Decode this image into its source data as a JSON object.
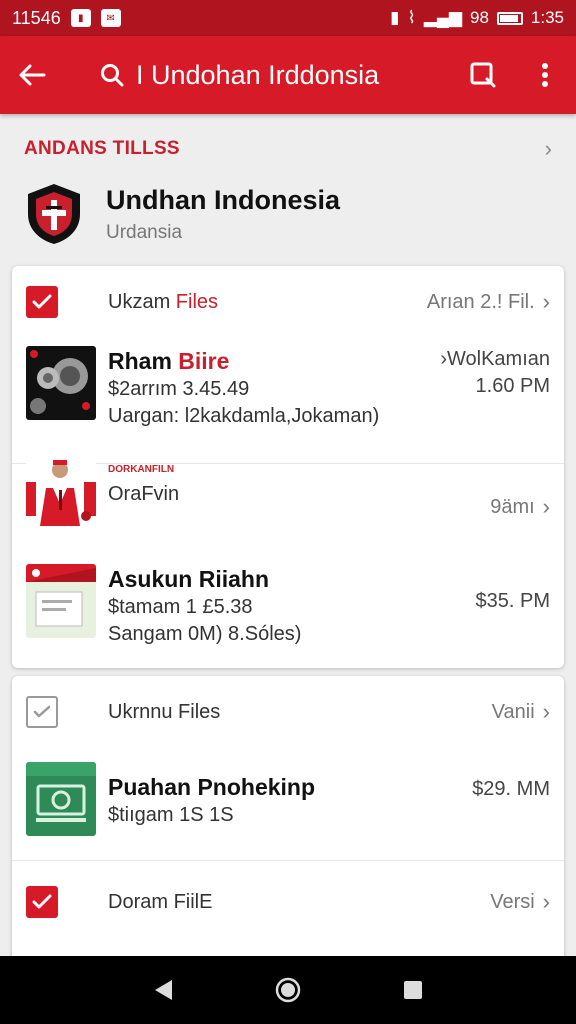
{
  "status_bar": {
    "left_time": "11546",
    "right_signal": "98",
    "right_time": "1:35"
  },
  "toolbar": {
    "search_text": "I Undohan Irddonsia"
  },
  "section": {
    "title": "ANDANS TILLSS"
  },
  "profile": {
    "name": "Undhan Indonesia",
    "subtitle": "Urdansia"
  },
  "card1": {
    "header": {
      "label_prefix": "Ukzam ",
      "label_accent": "Files",
      "right_text": "Arıan 2.! Fil."
    },
    "item1": {
      "title_prefix": "Rham ",
      "title_accent": "Biire",
      "line1": "$2arrım 3.45.49",
      "line2": "Uargan: l2kakdamla,Jokaman)",
      "right1": "›WolKamıan",
      "right2": "1.60 PM"
    },
    "item2": {
      "tag": "DORKANFILN",
      "label": "OraFvin",
      "right_text": "9ämı"
    },
    "item3": {
      "title": "Asukun Riiahn",
      "line1": "$tamam 1 £5.38",
      "line2": "Sangam 0M) 8.Sóles)",
      "right": "$35. PM"
    }
  },
  "card2": {
    "header": {
      "label": "Ukrnnu Files",
      "right_text": "Vanii"
    },
    "item1": {
      "title": "Puahan Pnohekinp",
      "line1": "$tiıgam 1S 1S",
      "right": "$29. MM"
    },
    "row3": {
      "label": "Doram FiilE",
      "right_text": "Versi"
    }
  },
  "colors": {
    "brand_red": "#d71a27",
    "status_red": "#b0141e",
    "accent_red": "#c8202c"
  }
}
